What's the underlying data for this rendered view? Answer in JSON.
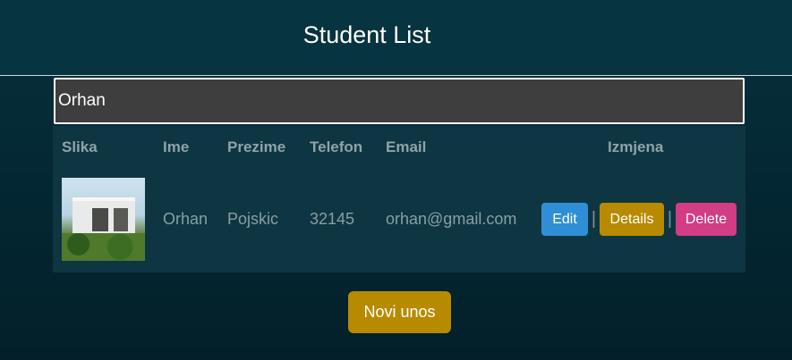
{
  "header": {
    "title": "Student List"
  },
  "search": {
    "value": "Orhan"
  },
  "table": {
    "columns": [
      "Slika",
      "Ime",
      "Prezime",
      "Telefon",
      "Email",
      "Izmjena"
    ],
    "rows": [
      {
        "image_icon": "house-photo",
        "ime": "Orhan",
        "prezime": "Pojskic",
        "telefon": "32145",
        "email": "orhan@gmail.com",
        "actions": {
          "edit": "Edit",
          "details": "Details",
          "delete": "Delete",
          "separator": "|"
        }
      }
    ]
  },
  "footer": {
    "new_button": "Novi unos"
  },
  "colors": {
    "edit": "#2e8fd6",
    "details": "#b88a00",
    "delete": "#d23d86",
    "new": "#b88a00"
  }
}
